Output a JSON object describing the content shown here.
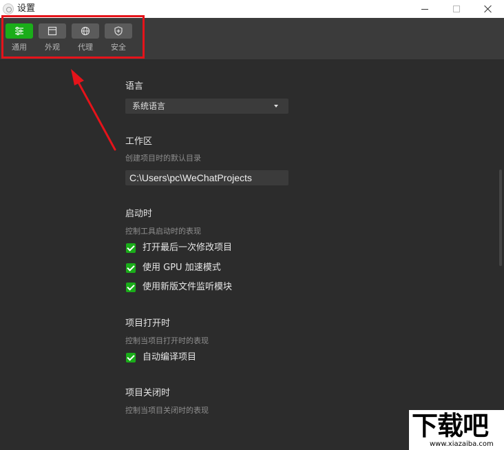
{
  "window": {
    "title": "设置"
  },
  "toolbar": {
    "items": [
      {
        "label": "通用",
        "icon": "settings-list-icon"
      },
      {
        "label": "外观",
        "icon": "window-layout-icon"
      },
      {
        "label": "代理",
        "icon": "globe-icon"
      },
      {
        "label": "安全",
        "icon": "shield-icon"
      }
    ],
    "active_index": 0
  },
  "language": {
    "title": "语言",
    "selected": "系统语言"
  },
  "workspace": {
    "title": "工作区",
    "desc": "创建项目时的默认目录",
    "path": "C:\\Users\\pc\\WeChatProjects"
  },
  "startup": {
    "title": "启动时",
    "desc": "控制工具启动时的表现",
    "options": [
      {
        "label": "打开最后一次修改项目",
        "checked": true
      },
      {
        "label": "使用 GPU 加速模式",
        "checked": true
      },
      {
        "label": "使用新版文件监听模块",
        "checked": true
      }
    ]
  },
  "project_open": {
    "title": "项目打开时",
    "desc": "控制当项目打开时的表现",
    "options": [
      {
        "label": "自动编译项目",
        "checked": true
      }
    ]
  },
  "project_close": {
    "title": "项目关闭时",
    "desc": "控制当项目关闭时的表现"
  },
  "watermark": {
    "text": "下载吧",
    "sub": "www.xiazaiba.com"
  },
  "colors": {
    "accent": "#1aad19",
    "annotation": "#e5131a",
    "background": "#2c2c2c",
    "toolbar": "#3b3b3b"
  }
}
